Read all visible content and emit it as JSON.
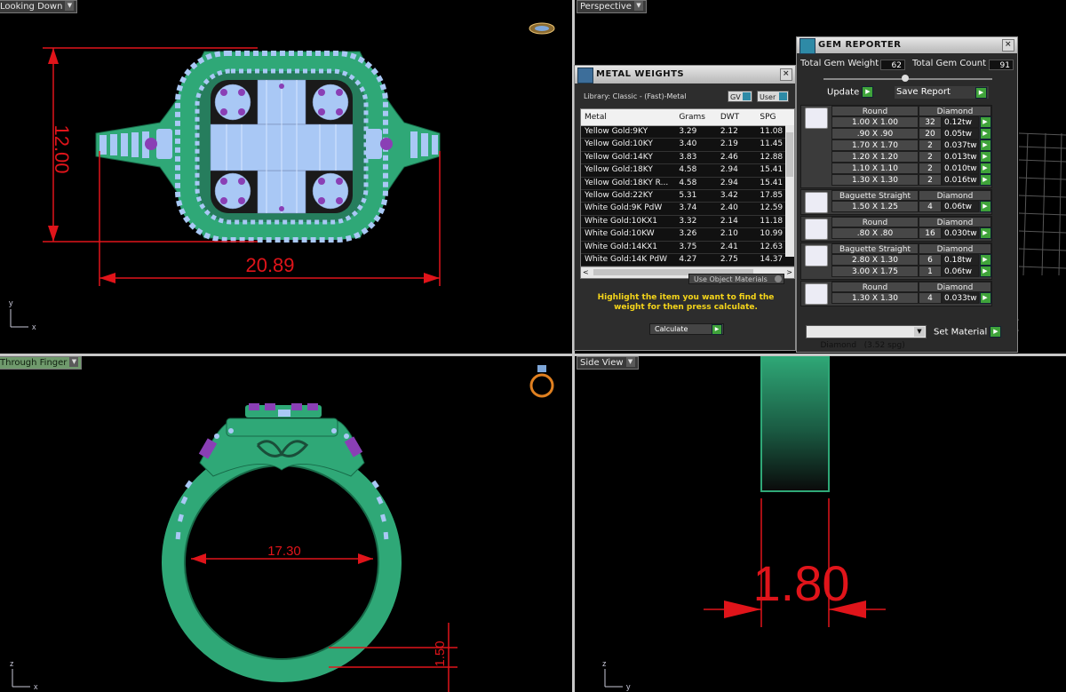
{
  "viewports": {
    "top_left": {
      "label": "Looking Down",
      "dim_height": "12.00",
      "dim_width": "20.89",
      "axis_v": "y",
      "axis_h": "x"
    },
    "top_right": {
      "label": "Perspective"
    },
    "bottom_left": {
      "label": "Through Finger",
      "dim_inner": "17.30",
      "dim_shank": "1.50",
      "axis_v": "z",
      "axis_h": "x"
    },
    "bottom_right": {
      "label": "Side View",
      "dim_thickness": "1.80",
      "axis_v": "z",
      "axis_h": "y"
    }
  },
  "metal_weights": {
    "title": "METAL WEIGHTS",
    "library": "Library: Classic - (Fast)-Metal",
    "gv_label": "GV",
    "user_label": "User",
    "columns": [
      "Metal",
      "Grams",
      "DWT",
      "SPG"
    ],
    "rows": [
      {
        "metal": "Yellow Gold:9KY",
        "grams": "3.29",
        "dwt": "2.12",
        "spg": "11.08"
      },
      {
        "metal": "Yellow Gold:10KY",
        "grams": "3.40",
        "dwt": "2.19",
        "spg": "11.45"
      },
      {
        "metal": "Yellow Gold:14KY",
        "grams": "3.83",
        "dwt": "2.46",
        "spg": "12.88"
      },
      {
        "metal": "Yellow Gold:18KY",
        "grams": "4.58",
        "dwt": "2.94",
        "spg": "15.41"
      },
      {
        "metal": "Yellow Gold:18KY R...",
        "grams": "4.58",
        "dwt": "2.94",
        "spg": "15.41"
      },
      {
        "metal": "Yellow Gold:22KY",
        "grams": "5.31",
        "dwt": "3.42",
        "spg": "17.85"
      },
      {
        "metal": "White Gold:9K PdW",
        "grams": "3.74",
        "dwt": "2.40",
        "spg": "12.59"
      },
      {
        "metal": "White Gold:10KX1",
        "grams": "3.32",
        "dwt": "2.14",
        "spg": "11.18"
      },
      {
        "metal": "White Gold:10KW",
        "grams": "3.26",
        "dwt": "2.10",
        "spg": "10.99"
      },
      {
        "metal": "White Gold:14KX1",
        "grams": "3.75",
        "dwt": "2.41",
        "spg": "12.63"
      },
      {
        "metal": "White Gold:14K PdW",
        "grams": "4.27",
        "dwt": "2.75",
        "spg": "14.37"
      }
    ],
    "use_object_materials": "Use Object Materials",
    "instruction": "Highlight the item you want to find the weight for then press calculate.",
    "calculate_label": "Calculate"
  },
  "gem_reporter": {
    "title": "GEM REPORTER",
    "total_weight_label": "Total Gem Weight",
    "total_weight_value": "62",
    "total_count_label": "Total Gem Count",
    "total_count_value": "91",
    "update_label": "Update",
    "save_report_label": "Save Report",
    "groups": [
      {
        "shape": "Round",
        "material": "Diamond",
        "rows": [
          {
            "size": "1.00 X 1.00",
            "count": "32",
            "tw": "0.12tw"
          },
          {
            "size": ".90 X .90",
            "count": "20",
            "tw": "0.05tw"
          },
          {
            "size": "1.70 X 1.70",
            "count": "2",
            "tw": "0.037tw"
          },
          {
            "size": "1.20 X 1.20",
            "count": "2",
            "tw": "0.013tw"
          },
          {
            "size": "1.10 X 1.10",
            "count": "2",
            "tw": "0.010tw"
          },
          {
            "size": "1.30 X 1.30",
            "count": "2",
            "tw": "0.016tw"
          }
        ]
      },
      {
        "shape": "Baguette Straight",
        "material": "Diamond",
        "rows": [
          {
            "size": "1.50 X 1.25",
            "count": "4",
            "tw": "0.06tw"
          }
        ]
      },
      {
        "shape": "Round",
        "material": "Diamond",
        "rows": [
          {
            "size": ".80 X .80",
            "count": "16",
            "tw": "0.030tw"
          }
        ]
      },
      {
        "shape": "Baguette Straight",
        "material": "Diamond",
        "rows": [
          {
            "size": "2.80 X 1.30",
            "count": "6",
            "tw": "0.18tw"
          },
          {
            "size": "3.00 X 1.75",
            "count": "1",
            "tw": "0.06tw"
          }
        ]
      },
      {
        "shape": "Round",
        "material": "Diamond",
        "rows": [
          {
            "size": "1.30 X 1.30",
            "count": "4",
            "tw": "0.033tw"
          }
        ]
      }
    ],
    "material_select": "Diamond   (3.52 spg)",
    "set_material_label": "Set Material"
  },
  "colors": {
    "metal_green": "#2fa877",
    "gem_blue": "#a9c8f5",
    "gem_purple": "#8a3fb5",
    "dimension_red": "#e0141a"
  }
}
